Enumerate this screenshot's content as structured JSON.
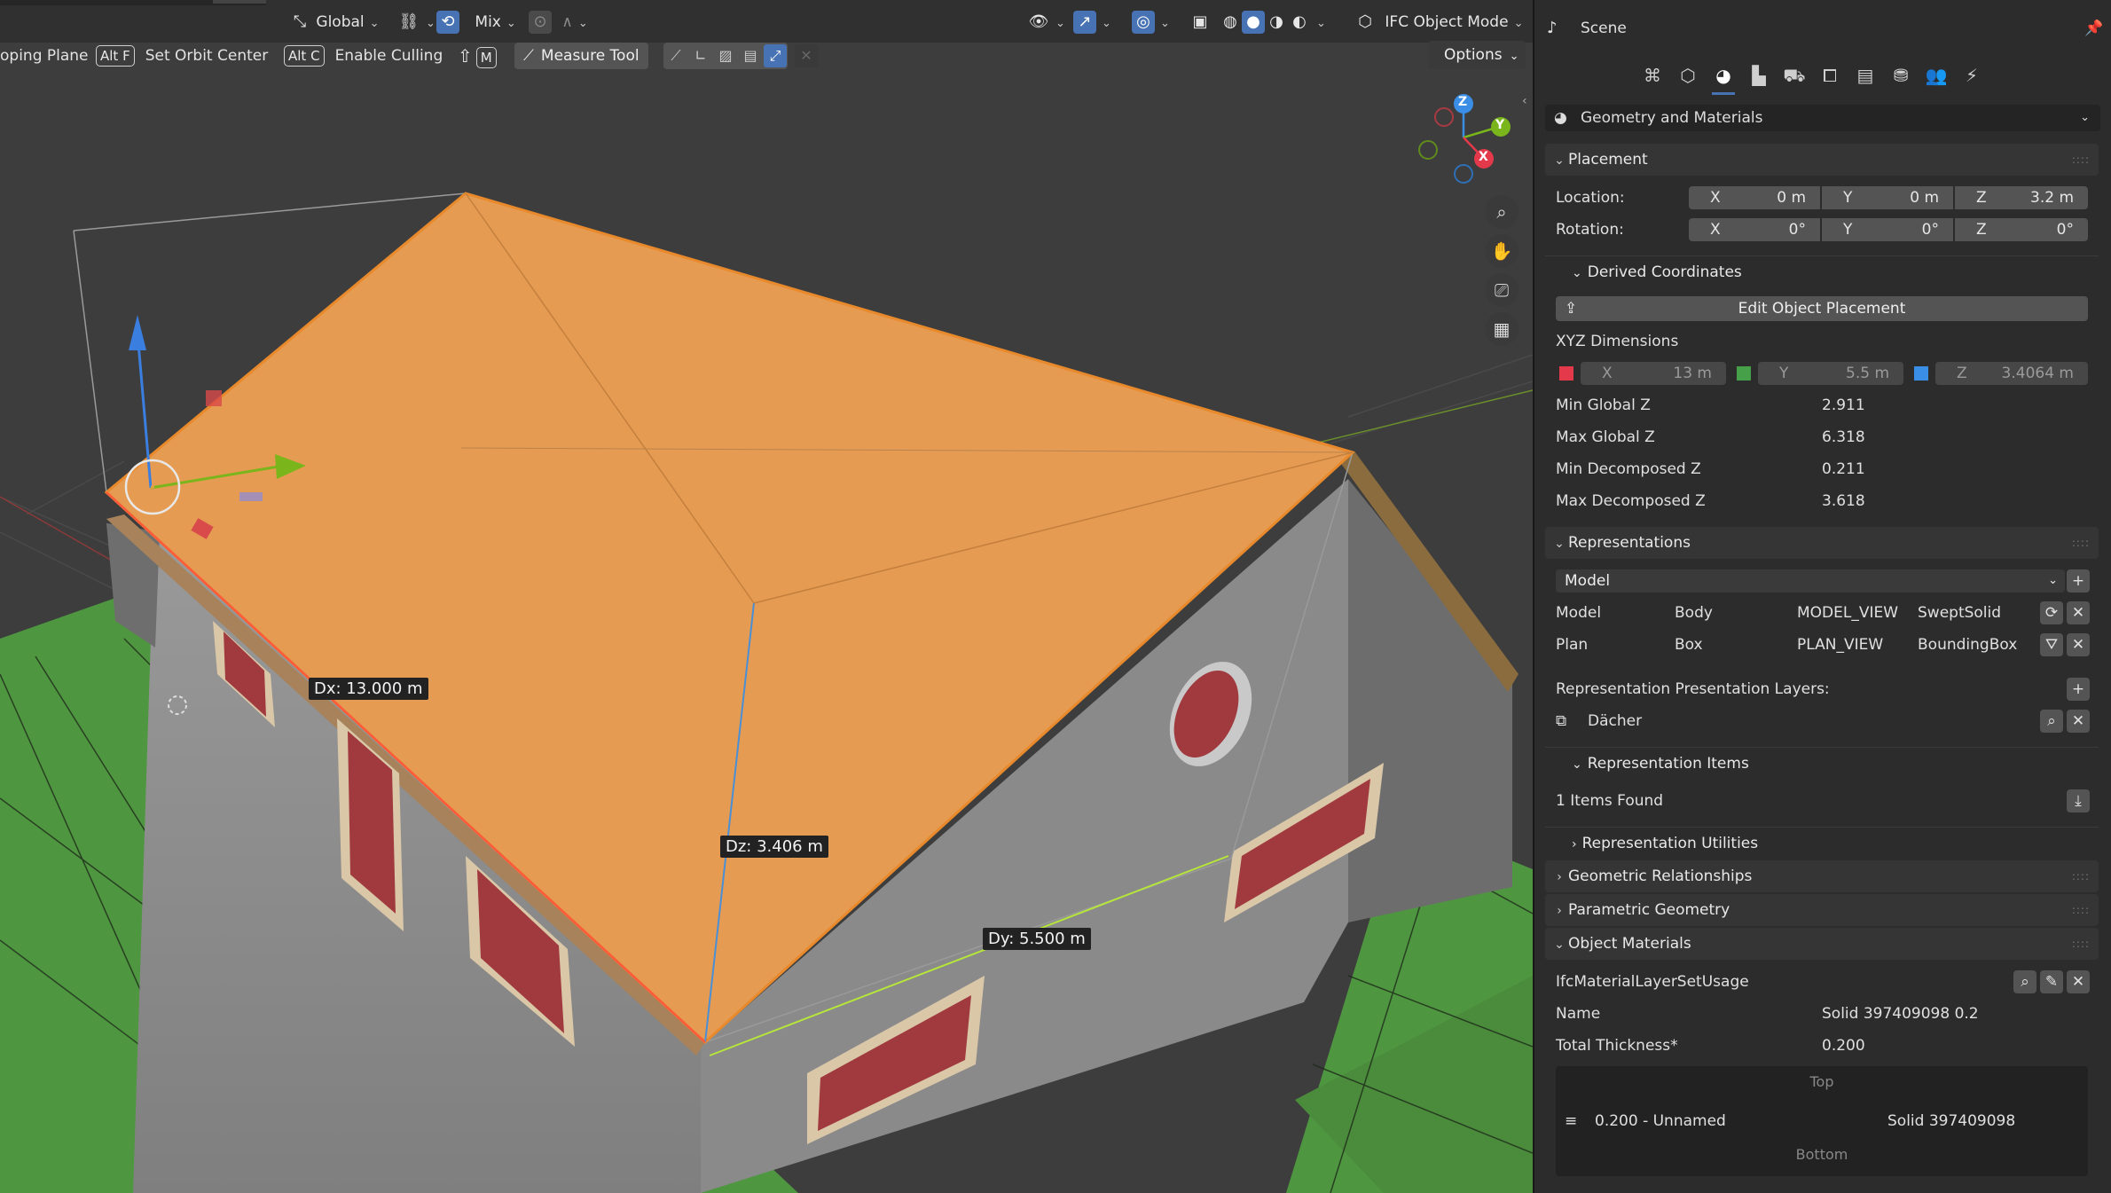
{
  "header": {
    "orientation": "Global",
    "pivot_label": "Mix",
    "mode": "IFC Object Mode"
  },
  "toolbar": {
    "clipping_plane": "oping Plane",
    "orbit_key": "Alt F",
    "orbit_label": "Set Orbit Center",
    "culling_key": "Alt C",
    "culling_label": "Enable Culling",
    "measure_key": "M",
    "measure_label": "Measure Tool",
    "options_label": "Options"
  },
  "viewport": {
    "dx_label": "Dx: 13.000 m",
    "dz_label": "Dz: 3.406 m",
    "dy_label": "Dy: 5.500 m",
    "gizmo_axes": [
      "Z",
      "Y",
      "X"
    ],
    "colors": {
      "roof": "#e69b52",
      "ground": "#4f9640",
      "wall": "#8f8f8f",
      "x_axis": "#e4394b",
      "y_axis": "#7ab51c",
      "z_axis": "#3a8ee6"
    }
  },
  "panel": {
    "title": "Scene",
    "context": "Geometry and Materials",
    "placement": {
      "header": "Placement",
      "location_label": "Location:",
      "location": {
        "x": "0 m",
        "y": "0 m",
        "z": "3.2 m"
      },
      "rotation_label": "Rotation:",
      "rotation": {
        "x": "0°",
        "y": "0°",
        "z": "0°"
      },
      "axis_x": "X",
      "axis_y": "Y",
      "axis_z": "Z"
    },
    "derived": {
      "header": "Derived Coordinates",
      "edit_button": "Edit Object Placement",
      "xyz_label": "XYZ Dimensions",
      "dims": {
        "x": "13 m",
        "y": "5.5 m",
        "z": "3.4064 m"
      },
      "rows": [
        {
          "label": "Min Global Z",
          "value": "2.911"
        },
        {
          "label": "Max Global Z",
          "value": "6.318"
        },
        {
          "label": "Min Decomposed Z",
          "value": "0.211"
        },
        {
          "label": "Max Decomposed Z",
          "value": "3.618"
        }
      ]
    },
    "representations": {
      "header": "Representations",
      "context_select": "Model",
      "rows": [
        {
          "context": "Model",
          "type": "Body",
          "view": "MODEL_VIEW",
          "kind": "SweptSolid"
        },
        {
          "context": "Plan",
          "type": "Box",
          "view": "PLAN_VIEW",
          "kind": "BoundingBox"
        }
      ],
      "layers_label": "Representation Presentation Layers:",
      "layer_name": "Dächer",
      "items_header": "Representation Items",
      "items_found": "1 Items Found",
      "utilities_header": "Representation Utilities"
    },
    "geometric_relationships": "Geometric Relationships",
    "parametric_geometry": "Parametric Geometry",
    "materials": {
      "header": "Object Materials",
      "usage": "IfcMaterialLayerSetUsage",
      "name_label": "Name",
      "name_value": "Solid 397409098 0.2",
      "thickness_label": "Total Thickness*",
      "thickness_value": "0.200",
      "top": "Top",
      "layer": "0.200 - Unnamed",
      "layer_material": "Solid 397409098",
      "bottom": "Bottom"
    }
  }
}
